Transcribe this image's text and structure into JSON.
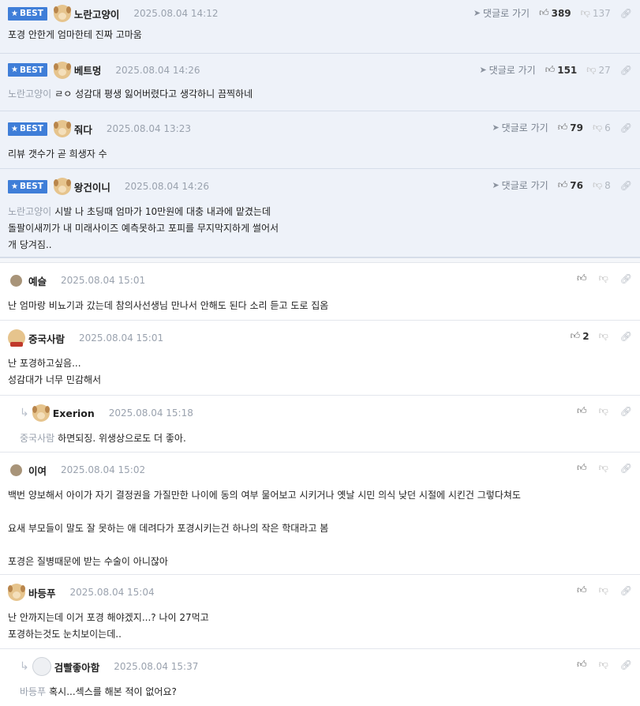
{
  "labels": {
    "best": "BEST",
    "goto": "댓글로 가기"
  },
  "icons": {
    "star": "star-icon",
    "plane": "paper-plane-icon",
    "thumb_up": "thumbs-up-icon",
    "thumb_down": "thumbs-down-icon",
    "link": "link-icon",
    "reply_arrow": "reply-arrow-icon"
  },
  "colors": {
    "best_badge": "#3f7ed8",
    "best_bg": "#eef2f9",
    "mention": "#9aa2ae"
  },
  "best_comments": [
    {
      "nick": "노란고양이",
      "date": "2025.08.04 14:12",
      "up": "389",
      "down": "137",
      "mention": "",
      "lines": [
        "포경 안한게 엄마한테 진짜 고마움"
      ]
    },
    {
      "nick": "베트멍",
      "date": "2025.08.04 14:26",
      "up": "151",
      "down": "27",
      "mention": "노란고양이",
      "lines": [
        "ㄹㅇ 성감대 평생 잃어버렸다고 생각하니 끔찍하네"
      ]
    },
    {
      "nick": "줘다",
      "date": "2025.08.04 13:23",
      "up": "79",
      "down": "6",
      "mention": "",
      "lines": [
        "리뷰 갯수가 곧 희생자 수"
      ]
    },
    {
      "nick": "왕건이니",
      "date": "2025.08.04 14:26",
      "up": "76",
      "down": "8",
      "mention": "노란고양이",
      "lines": [
        "시발 나 초딩때 엄마가 10만원에 대충 내과에 맡겼는데",
        "돌팔이새끼가 내 미래사이즈 예측못하고 포피를 무지막지하게 썰어서",
        "개 당겨짐.."
      ]
    }
  ],
  "comments": [
    {
      "nick": "예슬",
      "date": "2025.08.04 15:01",
      "up": "",
      "mention": "",
      "lines": [
        "난 엄마랑 비뇨기과 갔는데 참의사선생님 만나서 안해도 된다 소리 듣고 도로 집옴"
      ]
    },
    {
      "nick": "중국사람",
      "date": "2025.08.04 15:01",
      "up": "2",
      "mention": "",
      "lines": [
        "난 포경하고싶음...",
        "성감대가 너무 민감해서"
      ]
    },
    {
      "nick": "Exerion",
      "date": "2025.08.04 15:18",
      "up": "",
      "mention": "중국사람",
      "lines": [
        "하면되징. 위생상으로도 더 좋아."
      ]
    },
    {
      "nick": "이여",
      "date": "2025.08.04 15:02",
      "up": "",
      "mention": "",
      "lines": [
        "백번 양보해서 아이가 자기 결정권을 가질만한 나이에 동의 여부 물어보고 시키거나 옛날 시민 의식 낮던 시절에 시킨건 그렇다쳐도",
        "",
        "요새 부모들이 말도 잘 못하는 애 데려다가 포경시키는건 하나의 작은 학대라고 봄",
        "",
        "포경은 질병때문에 받는 수술이 아니잖아"
      ]
    },
    {
      "nick": "바등푸",
      "date": "2025.08.04 15:04",
      "up": "",
      "mention": "",
      "lines": [
        "난 안까지는데 이거 포경 해야겠지...? 나이 27먹고",
        "포경하는것도 눈치보이는데.."
      ]
    },
    {
      "nick": "검빨좋아함",
      "date": "2025.08.04 15:37",
      "up": "",
      "mention": "바등푸",
      "lines": [
        "혹시...섹스를 해본 적이 없어요?"
      ]
    }
  ]
}
